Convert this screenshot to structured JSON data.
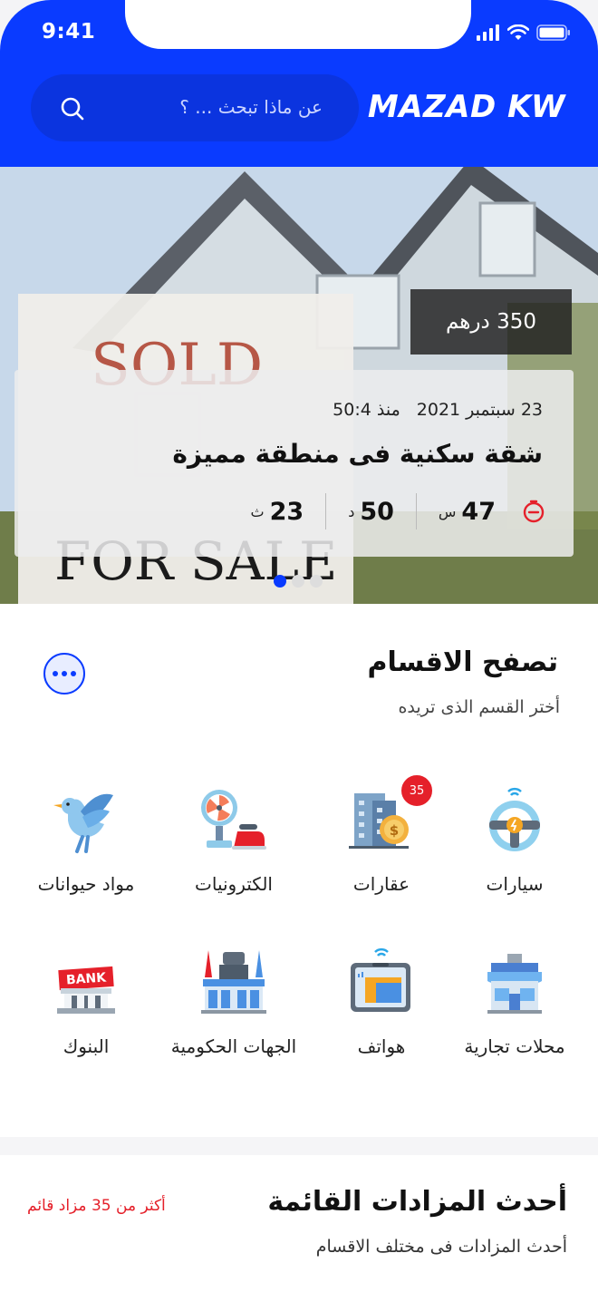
{
  "status_bar": {
    "time": "9:41"
  },
  "header": {
    "brand": "MAZAD KW",
    "search": {
      "placeholder": "عن ماذا تبحث ... ؟"
    }
  },
  "hero": {
    "price": "350 درهم",
    "date": "23 سبتمبر 2021",
    "since": "منذ 50:4",
    "title": "شقة سكنية فى منطقة مميزة",
    "countdown": [
      {
        "value": "47",
        "unit": "س"
      },
      {
        "value": "50",
        "unit": "د"
      },
      {
        "value": "23",
        "unit": "ث"
      }
    ],
    "slides": 3,
    "active_slide": 1
  },
  "categories": {
    "title": "تصفح الاقسام",
    "subtitle": "أختر القسم الذى تريده",
    "items": [
      {
        "label": "سيارات",
        "icon": "steering-wheel-icon"
      },
      {
        "label": "عقارات",
        "icon": "building-icon",
        "badge": "35"
      },
      {
        "label": "الكترونيات",
        "icon": "appliances-icon"
      },
      {
        "label": "مواد حيوانات",
        "icon": "bird-icon"
      },
      {
        "label": "محلات تجارية",
        "icon": "shop-icon"
      },
      {
        "label": "هواتف",
        "icon": "phone-icon"
      },
      {
        "label": "الجهات الحكومية",
        "icon": "government-icon"
      },
      {
        "label": "البنوك",
        "icon": "bank-icon",
        "sign": "BANK"
      }
    ]
  },
  "latest": {
    "title": "أحدث المزادات القائمة",
    "subtitle": "أحدث المزادات فى مختلف الاقسام",
    "count_text": "أكثر من 35 مزاد قائم"
  },
  "colors": {
    "brand_blue": "#0a3bff",
    "badge_red": "#e5202a"
  }
}
